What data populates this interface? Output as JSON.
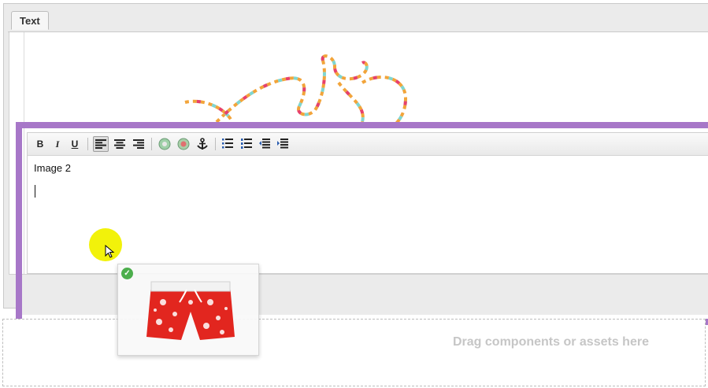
{
  "tab": {
    "label": "Text"
  },
  "toolbar": {
    "buttons": [
      {
        "label": "B"
      },
      {
        "label": "I"
      },
      {
        "label": "U"
      },
      {
        "label": "≡"
      },
      {
        "label": "≡"
      },
      {
        "label": "≡"
      }
    ],
    "icons": [
      "bold-icon",
      "italic-icon",
      "underline-icon",
      "align-left-icon",
      "align-center-icon",
      "align-right-icon",
      "link-icon",
      "unlink-icon",
      "anchor-icon",
      "bullet-list-icon",
      "numbered-list-icon",
      "outdent-icon",
      "indent-icon"
    ]
  },
  "editor": {
    "text": "Image 2"
  },
  "dropzone": {
    "text": "Drag components or assets here"
  },
  "colors": {
    "highlight_frame": "#a777c8",
    "cursor_halo": "#f2f20a",
    "check": "#4cae4c"
  }
}
